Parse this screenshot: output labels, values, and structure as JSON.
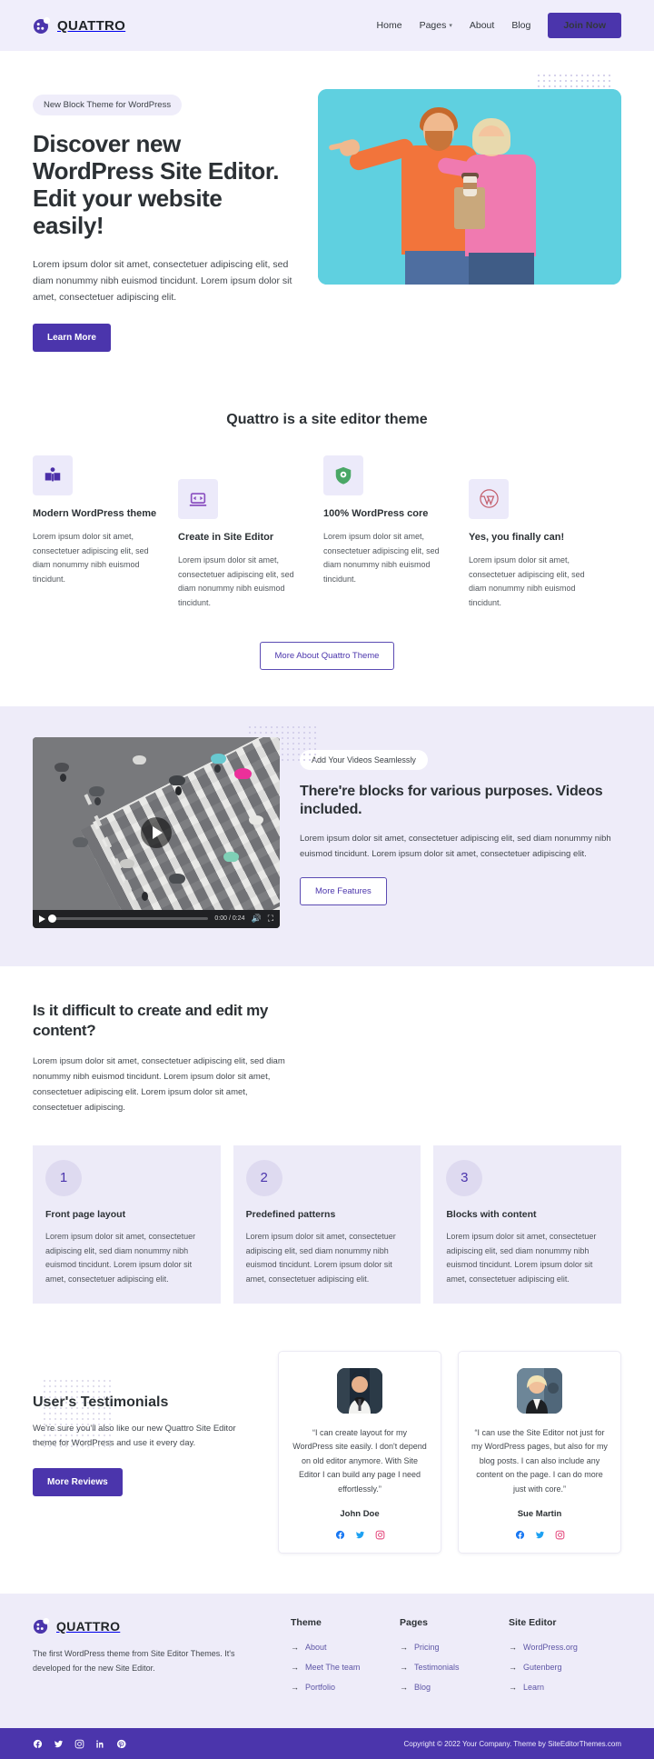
{
  "colors": {
    "brand": "#4b35ac",
    "header_bg": "#f0eefb",
    "section_bg": "#eeecf9",
    "text": "#32373c"
  },
  "header": {
    "brand": "QUATTRO",
    "nav": [
      {
        "label": "Home",
        "has_caret": false
      },
      {
        "label": "Pages",
        "has_caret": true
      },
      {
        "label": "About",
        "has_caret": false
      },
      {
        "label": "Blog",
        "has_caret": false
      }
    ],
    "cta": "Join Now"
  },
  "hero": {
    "pill": "New Block Theme for WordPress",
    "title": "Discover new WordPress Site Editor. Edit your website easily!",
    "description": "Lorem ipsum dolor sit amet, consectetuer adipiscing elit, sed diam nonummy nibh euismod tincidunt. Lorem ipsum dolor sit amet, consectetuer adipiscing elit.",
    "cta": "Learn More"
  },
  "features": {
    "title": "Quattro is a site editor theme",
    "items": [
      {
        "icon": "book-icon",
        "title": "Modern WordPress theme",
        "text": "Lorem ipsum dolor sit amet, consectetuer adipiscing elit, sed diam nonummy nibh euismod tincidunt."
      },
      {
        "icon": "code-laptop-icon",
        "title": "Create in Site Editor",
        "text": "Lorem ipsum dolor sit amet, consectetuer adipiscing elit, sed diam nonummy nibh euismod tincidunt."
      },
      {
        "icon": "shield-check-icon",
        "title": "100% WordPress core",
        "text": "Lorem ipsum dolor sit amet, consectetuer adipiscing elit, sed diam nonummy nibh euismod tincidunt."
      },
      {
        "icon": "wordpress-icon",
        "title": "Yes, you finally can!",
        "text": "Lorem ipsum dolor sit amet, consectetuer adipiscing elit, sed diam nonummy nibh euismod tincidunt."
      }
    ],
    "cta": "More About Quattro Theme"
  },
  "video_section": {
    "pill": "Add Your Videos Seamlessly",
    "title": "There're blocks for various purposes. Videos included.",
    "text": "Lorem ipsum dolor sit amet, consectetuer adipiscing elit, sed diam nonummy nibh euismod tincidunt. Lorem ipsum dolor sit amet, consectetuer adipiscing elit.",
    "cta": "More Features",
    "player": {
      "current_time": "0:00",
      "duration": "0:24",
      "time_display": "0:00 / 0:24"
    }
  },
  "steps_section": {
    "title": "Is it difficult to create and edit my content?",
    "text": "Lorem ipsum dolor sit amet, consectetuer adipiscing elit, sed diam nonummy nibh euismod tincidunt. Lorem ipsum dolor sit amet, consectetuer adipiscing elit. Lorem ipsum dolor sit amet, consectetuer adipiscing.",
    "steps": [
      {
        "number": "1",
        "title": "Front page layout",
        "text": "Lorem ipsum dolor sit amet, consectetuer adipiscing elit, sed diam nonummy nibh euismod tincidunt. Lorem ipsum dolor sit amet, consectetuer adipiscing elit."
      },
      {
        "number": "2",
        "title": "Predefined patterns",
        "text": "Lorem ipsum dolor sit amet, consectetuer adipiscing elit, sed diam nonummy nibh euismod tincidunt. Lorem ipsum dolor sit amet, consectetuer adipiscing elit."
      },
      {
        "number": "3",
        "title": "Blocks with content",
        "text": "Lorem ipsum dolor sit amet, consectetuer adipiscing elit, sed diam nonummy nibh euismod tincidunt. Lorem ipsum dolor sit amet, consectetuer adipiscing elit."
      }
    ]
  },
  "testimonials": {
    "title": "User's Testimonials",
    "text": "We're sure you'll also like our new Quattro Site Editor theme for WordPress and use it every day.",
    "cta": "More Reviews",
    "cards": [
      {
        "avatar": "avatar-john-doe",
        "quote": "“I can create layout for my WordPress site easily. I don't depend on old editor anymore. With Site Editor I can build any page I need effortlessly.”",
        "author": "John Doe",
        "socials": [
          "facebook-icon",
          "twitter-icon",
          "instagram-icon"
        ]
      },
      {
        "avatar": "avatar-sue-martin",
        "quote": "“I can use the Site Editor not just for my WordPress pages, but also for my blog posts. I can also include any content on the page. I can do more just with core.”",
        "author": "Sue Martin",
        "socials": [
          "facebook-icon",
          "twitter-icon",
          "instagram-icon"
        ]
      }
    ]
  },
  "footer": {
    "brand": "QUATTRO",
    "about": "The first WordPress theme from Site Editor Themes. It's developed for the new Site Editor.",
    "columns": [
      {
        "heading": "Theme",
        "links": [
          "About",
          "Meet The team",
          "Portfolio"
        ]
      },
      {
        "heading": "Pages",
        "links": [
          "Pricing",
          "Testimonials",
          "Blog"
        ]
      },
      {
        "heading": "Site Editor",
        "links": [
          "WordPress.org",
          "Gutenberg",
          "Learn"
        ]
      }
    ],
    "bar": {
      "socials": [
        "facebook-icon",
        "twitter-icon",
        "instagram-icon",
        "linkedin-icon",
        "pinterest-icon"
      ],
      "copyright": "Copyright © 2022 Your Company. Theme by SiteEditorThemes.com"
    }
  }
}
